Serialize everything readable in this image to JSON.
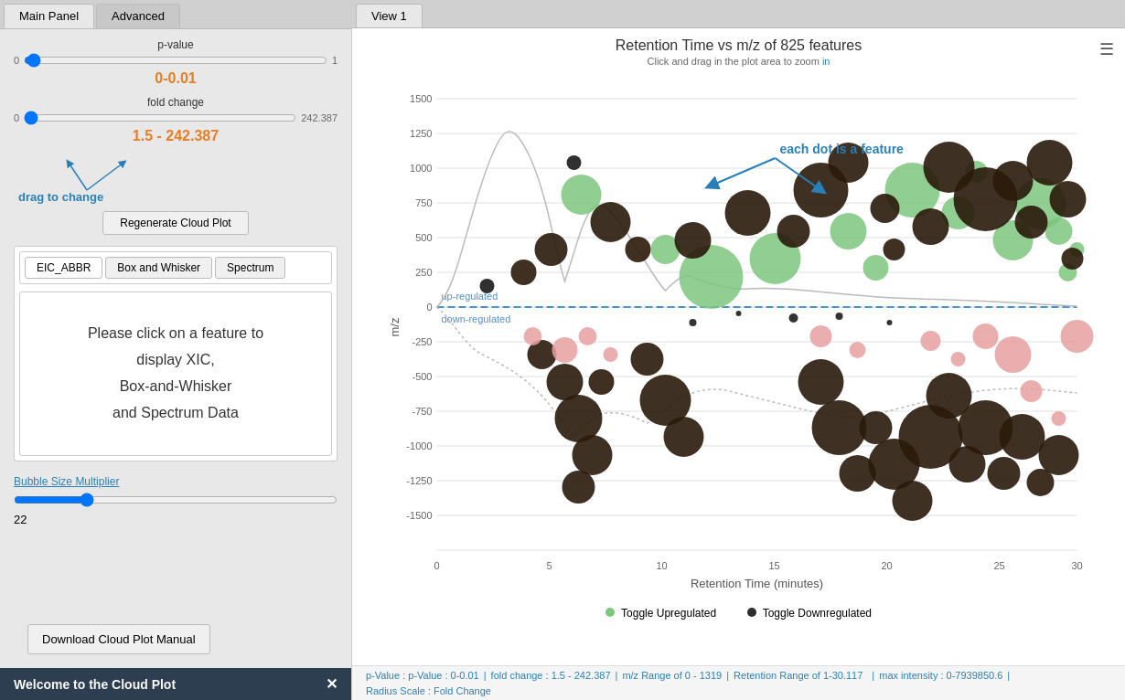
{
  "tabs": {
    "main": "Main Panel",
    "advanced": "Advanced"
  },
  "right_tab": "View 1",
  "pvalue": {
    "label": "p-value",
    "min": "0",
    "max": "1",
    "value": "0-0.01"
  },
  "foldchange": {
    "label": "fold change",
    "min": "0",
    "max": "242.387",
    "value": "1.5 - 242.387"
  },
  "regen_btn": "Regenerate Cloud Plot",
  "drag_label": "drag to change",
  "sub_tabs": [
    "EIC_ABBR",
    "Box and Whisker",
    "Spectrum"
  ],
  "feature_msg_line1": "Please click on a feature to",
  "feature_msg_line2": "display XIC,",
  "feature_msg_line3": "Box-and-Whisker",
  "feature_msg_line4": "and Spectrum Data",
  "bubble_label": "Bubble Size Multiplier",
  "bubble_value": "22",
  "download_btn": "Download Cloud Plot Manual",
  "welcome_text": "Welcome to the Cloud Plot",
  "chart_title": "Retention Time vs m/z of 825 features",
  "chart_subtitle": "Click and drag in the plot area to zoom",
  "chart_subtitle_link": "in",
  "callout_text": "each dot is a feature",
  "toggle_upregulated": "Toggle Upregulated",
  "toggle_downregulated": "Toggle Downregulated",
  "status": {
    "pvalue": "p-Value : 0-0.01",
    "foldchange": "fold change : 1.5 - 242.387",
    "mz_range": "m/z Range of 0 - 1319",
    "rt_range": "Retention Range of 1-30.117",
    "max_intensity": "max intensity : 0-7939850.6",
    "radius_scale": "Radius Scale : Fold Change"
  },
  "chart": {
    "x_label": "Retention Time (minutes)",
    "y_label": "m/z",
    "x_ticks": [
      "0",
      "5",
      "10",
      "15",
      "20",
      "25",
      "30"
    ],
    "y_ticks": [
      "1500",
      "1250",
      "1000",
      "750",
      "500",
      "250",
      "0",
      "-250",
      "-500",
      "-750",
      "-1000",
      "-1250",
      "-1500"
    ],
    "up_regulated_label": "up-regulated",
    "down_regulated_label": "down-regulated"
  },
  "colors": {
    "accent_blue": "#2980b9",
    "orange": "#e67e22",
    "green_bubble": "#7dc67e",
    "dark_bubble": "#2a1a0a",
    "pink_bubble": "#e8a0a0",
    "dashed_line": "#4a90d9"
  }
}
